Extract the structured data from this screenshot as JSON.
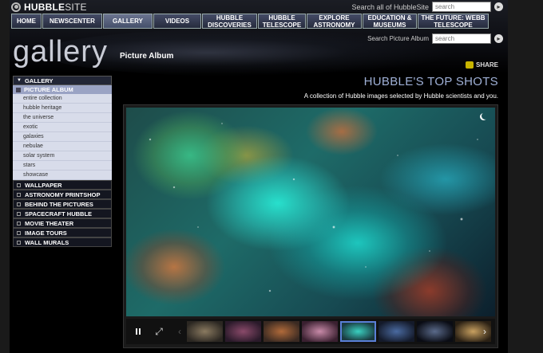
{
  "site": {
    "logo_bold": "HUBBLE",
    "logo_rest": "SITE"
  },
  "search_site": {
    "label": "Search all of HubbleSite",
    "placeholder": "search"
  },
  "nav": [
    {
      "label": "HOME",
      "width": 38
    },
    {
      "label": "NEWSCENTER",
      "width": 75
    },
    {
      "label": "GALLERY",
      "width": 62,
      "active": true
    },
    {
      "label": "VIDEOS",
      "width": 60
    },
    {
      "label": "HUBBLE DISCOVERIES",
      "width": 69
    },
    {
      "label": "HUBBLE TELESCOPE",
      "width": 60
    },
    {
      "label": "EXPLORE ASTRONOMY",
      "width": 69
    },
    {
      "label": "EDUCATION & MUSEUMS",
      "width": 68
    },
    {
      "label": "THE FUTURE: WEBB TELESCOPE",
      "width": 89
    }
  ],
  "search_picture": {
    "label": "Search Picture Album",
    "placeholder": "search"
  },
  "page": {
    "section_title": "gallery",
    "album_title": "Picture Album",
    "share": "SHARE"
  },
  "feature": {
    "title": "HUBBLE'S TOP SHOTS",
    "subtitle": "A collection of Hubble images selected by Hubble scientists and you."
  },
  "sidebar": {
    "head": "GALLERY",
    "active": "PICTURE ALBUM",
    "sub_items": [
      "entire collection",
      "hubble heritage",
      "the universe",
      "exotic",
      "galaxies",
      "nebulae",
      "solar system",
      "stars",
      "showcase"
    ],
    "sections": [
      "WALLPAPER",
      "ASTRONOMY PRINTSHOP",
      "BEHIND THE PICTURES",
      "SPACECRAFT HUBBLE",
      "MOVIE THEATER",
      "IMAGE TOURS",
      "WALL MURALS"
    ]
  },
  "viewer": {
    "thumbnails": [
      {
        "name": "spiral-galaxy",
        "colors": [
          "#8a7a60",
          "#2b2722"
        ]
      },
      {
        "name": "purple-nebula",
        "colors": [
          "#8a4a6a",
          "#2a1a2a"
        ]
      },
      {
        "name": "orange-nebula",
        "colors": [
          "#b06a3a",
          "#3a2a22"
        ]
      },
      {
        "name": "pink-nebula",
        "colors": [
          "#c88aa8",
          "#3a2030"
        ]
      },
      {
        "name": "teal-nebula",
        "colors": [
          "#3ad0c0",
          "#1a3a40"
        ]
      },
      {
        "name": "blue-galaxy",
        "colors": [
          "#4a6aa0",
          "#141a2a"
        ]
      },
      {
        "name": "dark-galaxy",
        "colors": [
          "#5a6a8a",
          "#0a0c14"
        ]
      },
      {
        "name": "golden-cluster",
        "colors": [
          "#c8a060",
          "#2a2014"
        ]
      }
    ],
    "selected_index": 4
  }
}
